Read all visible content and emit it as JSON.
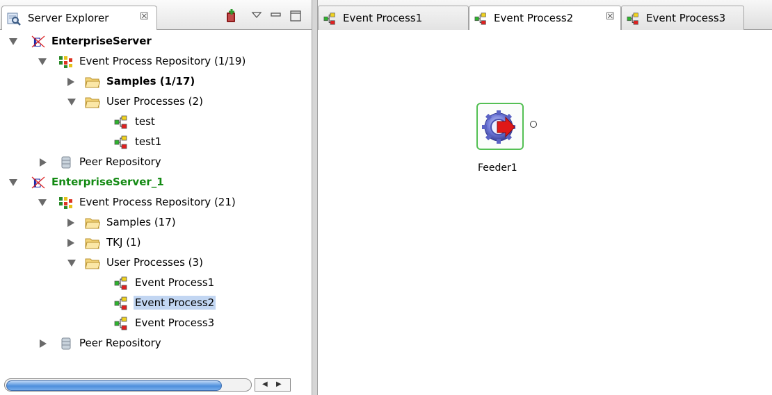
{
  "left_view": {
    "tab_label": "Server Explorer",
    "tab_close_glyph": "☒",
    "tools": [
      "new-server-icon",
      "view-menu-icon",
      "minimize-icon",
      "maximize-icon"
    ]
  },
  "tree": {
    "server1": {
      "label": "EnterpriseServer",
      "repository": "Event Process Repository (1/19)",
      "samples": "Samples (1/17)",
      "user_processes": "User Processes (2)",
      "procs": [
        "test",
        "test1"
      ],
      "peer": "Peer Repository"
    },
    "server2": {
      "label": "EnterpriseServer_1",
      "repository": "Event Process Repository (21)",
      "samples": "Samples (17)",
      "tkj": "TKJ (1)",
      "user_processes": "User Processes (3)",
      "procs": [
        "Event Process1",
        "Event Process2",
        "Event Process3"
      ],
      "peer": "Peer Repository"
    }
  },
  "editor": {
    "tabs": [
      {
        "label": "Event Process1",
        "active": false
      },
      {
        "label": "Event Process2",
        "active": true,
        "close_glyph": "☒"
      },
      {
        "label": "Event Process3",
        "active": false
      }
    ],
    "node": {
      "label": "Feeder1",
      "icon": "feeder-gear-icon"
    }
  },
  "colors": {
    "selection": "#c2d6f2",
    "server2_label": "#138a13",
    "node_border": "#54c054"
  }
}
